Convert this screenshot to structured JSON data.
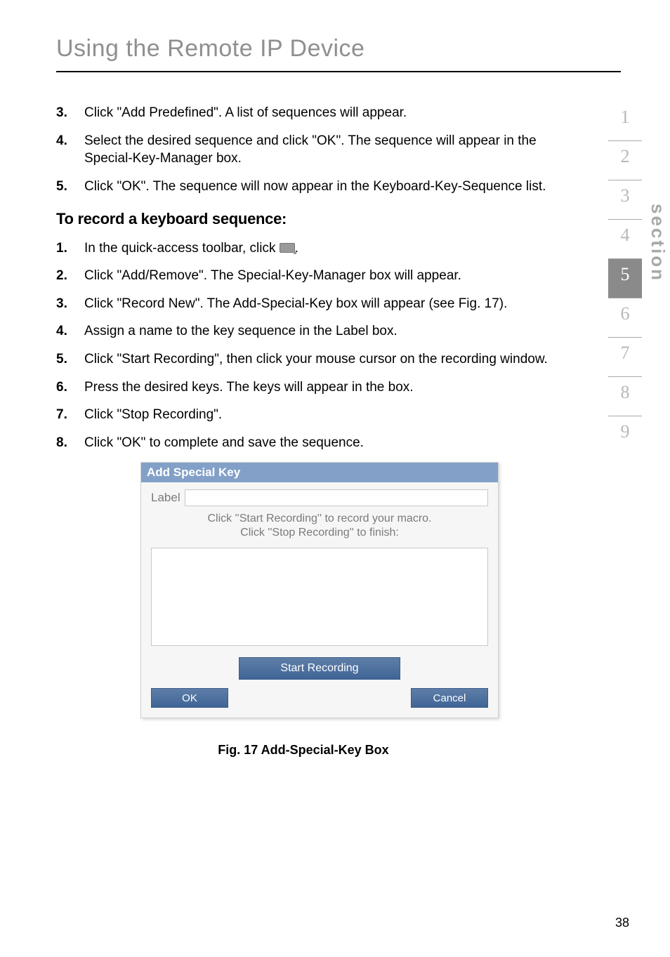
{
  "header": {
    "title": "Using the Remote IP Device"
  },
  "first_list": [
    {
      "n": "3.",
      "t": "Click \"Add Predefined\". A list of sequences will appear."
    },
    {
      "n": "4.",
      "t": "Select the desired sequence and click \"OK\". The sequence will appear in the Special-Key-Manager box."
    },
    {
      "n": "5.",
      "t": "Click \"OK\". The sequence will now appear in the Keyboard-Key-Sequence list."
    }
  ],
  "subheading": "To record a keyboard sequence:",
  "second_list": [
    {
      "n": "1.",
      "t_pre": "In the quick-access toolbar, click ",
      "icon": true,
      "t_post": "."
    },
    {
      "n": "2.",
      "t": "Click \"Add/Remove\". The Special-Key-Manager box will appear."
    },
    {
      "n": "3.",
      "t": "Click \"Record New\". The Add-Special-Key box will appear (see Fig. 17)."
    },
    {
      "n": "4.",
      "t": "Assign a name to the key sequence in the Label box."
    },
    {
      "n": "5.",
      "t": "Click \"Start Recording\", then click your mouse cursor on the recording window."
    },
    {
      "n": "6.",
      "t": "Press the desired keys. The keys will appear in the box."
    },
    {
      "n": "7.",
      "t": "Click \"Stop Recording\"."
    },
    {
      "n": "8.",
      "t": "Click \"OK\" to complete and save the sequence."
    }
  ],
  "dialog": {
    "title": "Add Special Key",
    "label_text": "Label",
    "label_value": "",
    "instructions_line1": "Click ''Start Recording'' to record your macro.",
    "instructions_line2": "Click ''Stop Recording'' to finish:",
    "textarea_value": "",
    "start_btn": "Start Recording",
    "ok_btn": "OK",
    "cancel_btn": "Cancel"
  },
  "figure_caption": "Fig. 17 Add-Special-Key Box",
  "section_nav": {
    "items": [
      "1",
      "2",
      "3",
      "4",
      "5",
      "6",
      "7",
      "8",
      "9"
    ],
    "active_index": 4,
    "label": "section"
  },
  "page_number": "38"
}
